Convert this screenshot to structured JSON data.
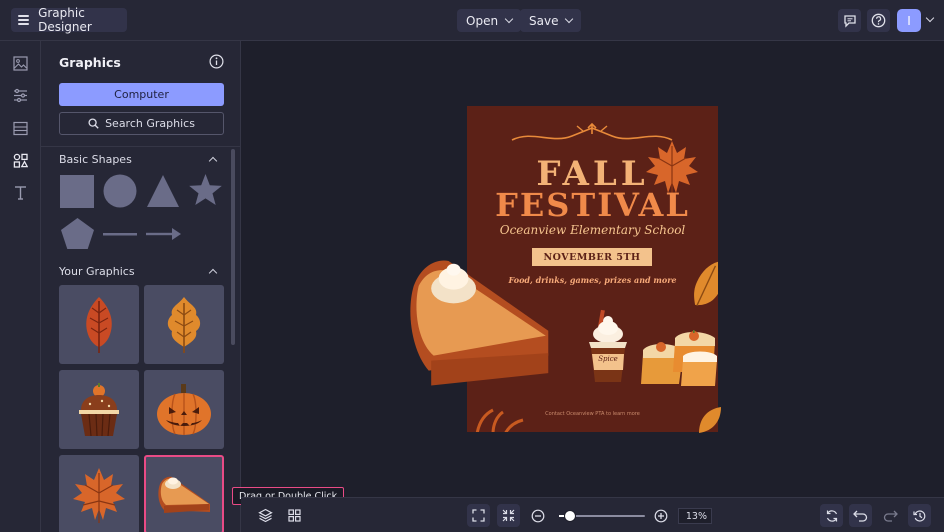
{
  "topbar": {
    "app_title": "Graphic Designer",
    "open_label": "Open",
    "save_label": "Save",
    "avatar_initial": "I"
  },
  "rail": {
    "icons": [
      "image-icon",
      "sliders-icon",
      "background-icon",
      "graphics-icon",
      "text-icon"
    ],
    "active": "graphics-icon"
  },
  "panel": {
    "title": "Graphics",
    "computer_label": "Computer",
    "search_label": "Search Graphics",
    "sections": {
      "basic_shapes": "Basic Shapes",
      "your_graphics": "Your Graphics"
    },
    "shapes": [
      "square",
      "circle",
      "triangle",
      "star",
      "pentagon",
      "line",
      "arrow"
    ],
    "graphics": [
      "red-leaf",
      "orange-leaf",
      "cupcake",
      "jack-o-lantern",
      "maple-leaf",
      "pumpkin-pie-slice"
    ],
    "selected_graphic": "pumpkin-pie-slice"
  },
  "poster": {
    "line1": "FALL",
    "line2": "FESTIVAL",
    "school": "Oceanview Elementary School",
    "date": "NOVEMBER 5TH",
    "tagline": "Food, drinks, games, prizes and more",
    "contact": "Contact Oceanview PTA to learn more",
    "cup_label": "Spice"
  },
  "tooltip": "Drag or Double Click",
  "zoom": {
    "value_label": "13%",
    "slider_fraction": 0.13
  },
  "colors": {
    "accent": "#8c9bff",
    "highlight": "#e94b86",
    "poster_bg": "#5c2117"
  }
}
